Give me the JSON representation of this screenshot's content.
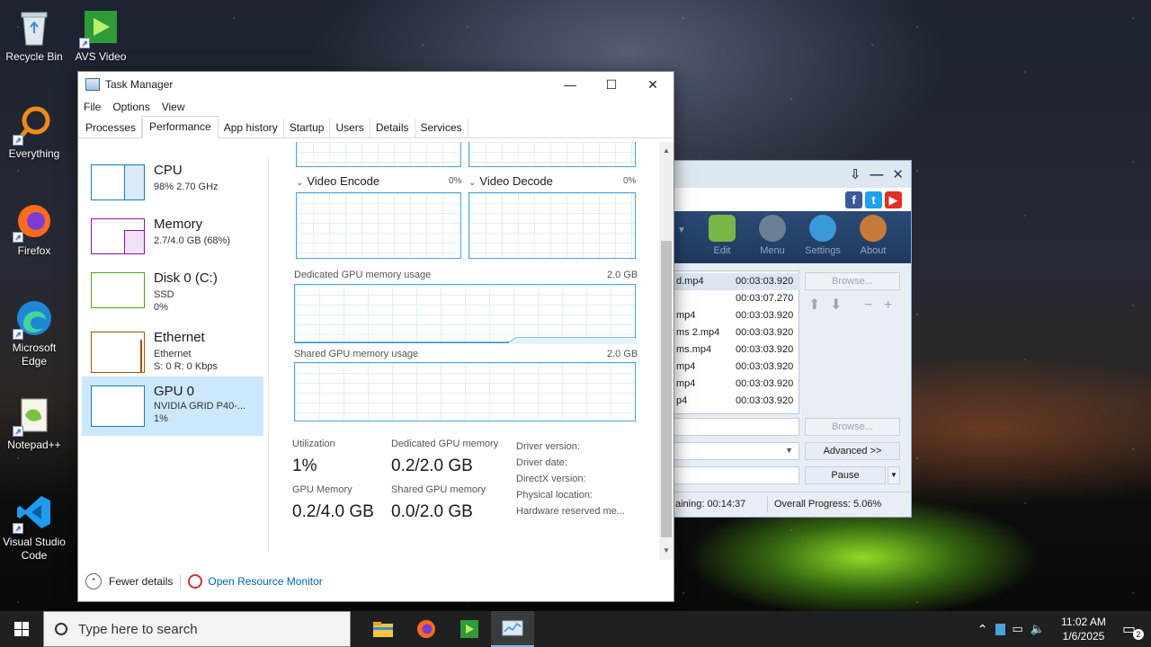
{
  "desktop": {
    "icons": [
      {
        "label": "Recycle Bin"
      },
      {
        "label": "AVS Video"
      },
      {
        "label": "Everything"
      },
      {
        "label": "Firefox"
      },
      {
        "label": "Microsoft Edge"
      },
      {
        "label": "Notepad++"
      },
      {
        "label": "Visual Studio Code"
      }
    ]
  },
  "taskmanager": {
    "title": "Task Manager",
    "controls": {
      "minimize": "—",
      "maximize": "☐",
      "close": "✕"
    },
    "menu": [
      "File",
      "Options",
      "View"
    ],
    "tabs": [
      "Processes",
      "Performance",
      "App history",
      "Startup",
      "Users",
      "Details",
      "Services"
    ],
    "active_tab": "Performance",
    "sidebar": {
      "cpu": {
        "name": "CPU",
        "sub1": "98%  2.70 GHz",
        "color": "#117dbb"
      },
      "memory": {
        "name": "Memory",
        "sub1": "2.7/4.0 GB (68%)",
        "color": "#8b12ae"
      },
      "disk": {
        "name": "Disk 0 (C:)",
        "sub1": "SSD",
        "sub2": "0%",
        "color": "#4da60c"
      },
      "ethernet": {
        "name": "Ethernet",
        "sub1": "Ethernet",
        "sub2": "S: 0  R: 0 Kbps",
        "color": "#a74f01"
      },
      "gpu": {
        "name": "GPU 0",
        "sub1": "NVIDIA GRID P40-...",
        "sub2": "1%",
        "color": "#117dbb"
      }
    },
    "gpu_detail": {
      "video_encode": {
        "label": "Video Encode",
        "pct": "0%"
      },
      "video_decode": {
        "label": "Video Decode",
        "pct": "0%"
      },
      "dedicated_label": "Dedicated GPU memory usage",
      "dedicated_max": "2.0 GB",
      "shared_label": "Shared GPU memory usage",
      "shared_max": "2.0 GB",
      "stats": {
        "utilization_label": "Utilization",
        "utilization_value": "1%",
        "dedicated_mem_label": "Dedicated GPU memory",
        "dedicated_mem_value": "0.2/2.0 GB",
        "gpu_memory_label": "GPU Memory",
        "gpu_memory_value": "0.2/4.0 GB",
        "shared_mem_label": "Shared GPU memory",
        "shared_mem_value": "0.0/2.0 GB"
      },
      "driver_fields": [
        "Driver version:",
        "Driver date:",
        "DirectX version:",
        "Physical location:",
        "Hardware reserved me..."
      ]
    },
    "footer": {
      "fewer_details": "Fewer details",
      "open_resource_monitor": "Open Resource Monitor"
    }
  },
  "avs": {
    "social": [
      "f",
      "t",
      "▶"
    ],
    "toolbar": [
      "Edit",
      "Menu",
      "Settings",
      "About"
    ],
    "files": [
      {
        "name": "d.mp4",
        "duration": "00:03:03.920"
      },
      {
        "name": "",
        "duration": "00:03:07.270"
      },
      {
        "name": "mp4",
        "duration": "00:03:03.920"
      },
      {
        "name": "ms 2.mp4",
        "duration": "00:03:03.920"
      },
      {
        "name": "ms.mp4",
        "duration": "00:03:03.920"
      },
      {
        "name": "mp4",
        "duration": "00:03:03.920"
      },
      {
        "name": "mp4",
        "duration": "00:03:03.920"
      },
      {
        "name": "p4",
        "duration": "00:03:03.920"
      }
    ],
    "browse1": "Browse...",
    "browse2": "Browse...",
    "advanced": "Advanced >>",
    "pause": "Pause",
    "remaining": "aining: 00:14:37",
    "overall": "Overall Progress: 5.06%"
  },
  "taskbar": {
    "search_placeholder": "Type here to search",
    "time": "11:02 AM",
    "date": "1/6/2025",
    "notification_count": "2"
  }
}
